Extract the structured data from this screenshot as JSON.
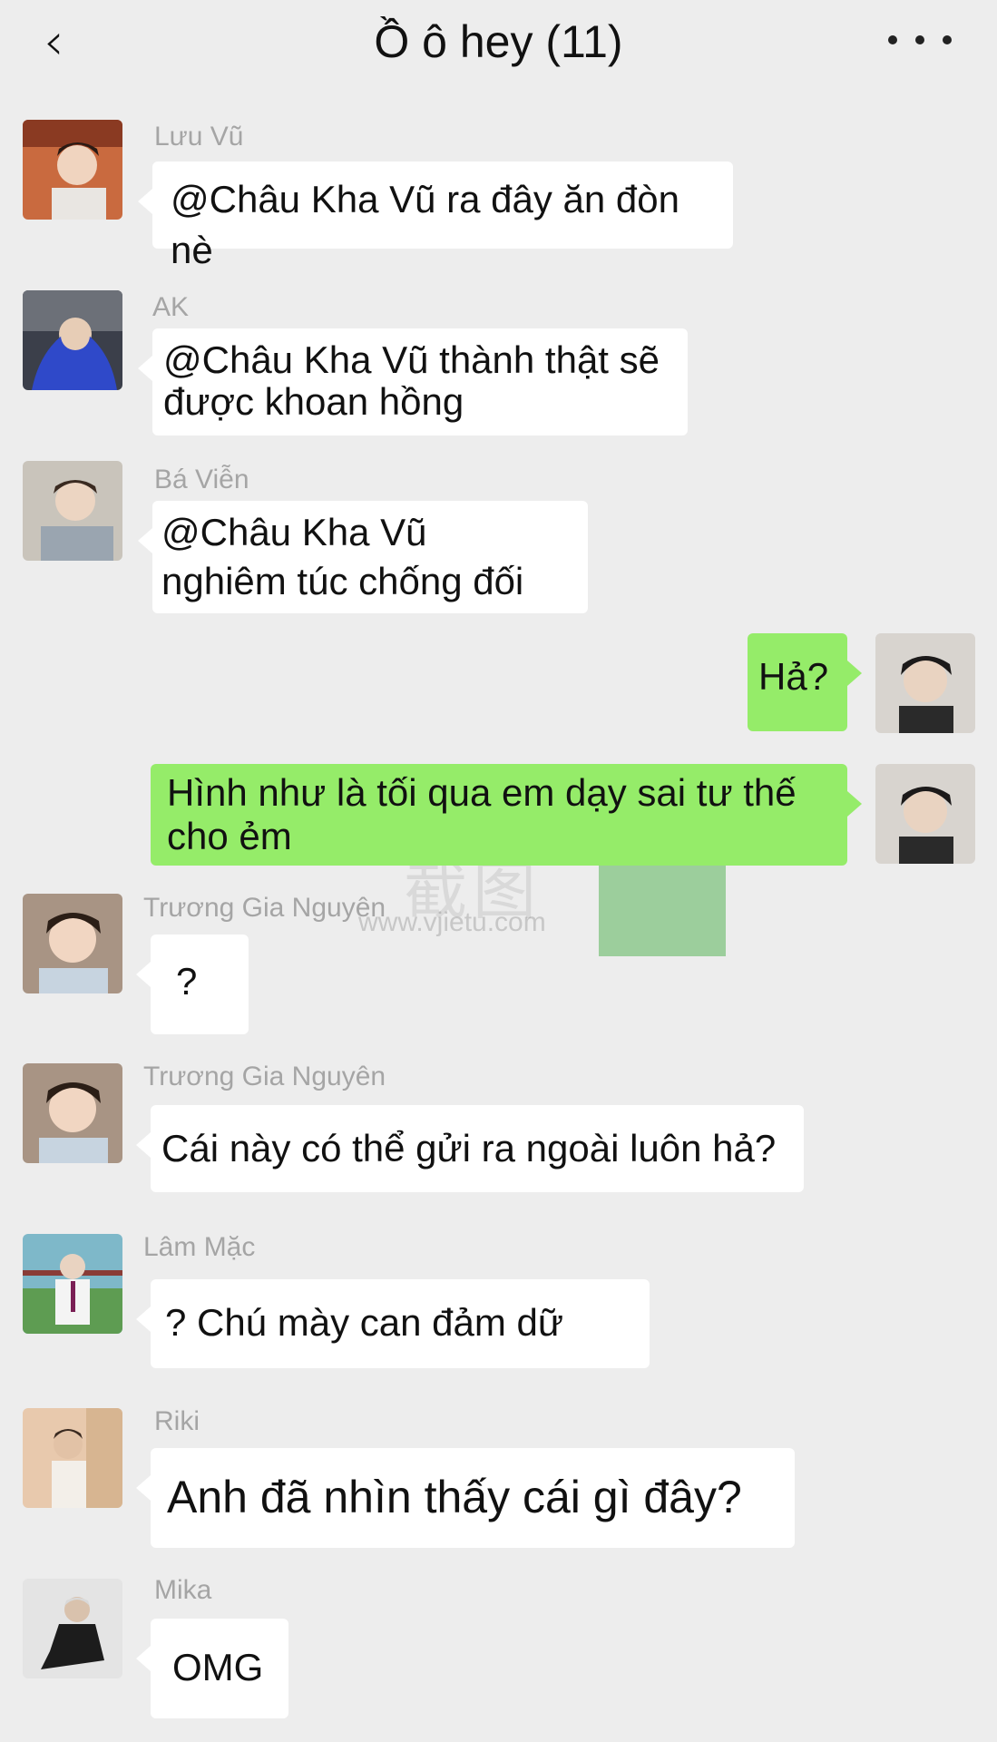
{
  "header": {
    "back_icon": "chevron-left-icon",
    "title": "Ồ ô hey (11)",
    "more_icon": "more-dots-icon"
  },
  "watermark": {
    "chinese": "截图",
    "url": "www.vjietu.com"
  },
  "messages": [
    {
      "sender": "Lưu Vũ",
      "text": "@Châu Kha Vũ ra đây ăn đòn nè",
      "side": "left"
    },
    {
      "sender": "AK",
      "text": "@Châu Kha Vũ thành thật sẽ\nđược khoan hồng",
      "side": "left"
    },
    {
      "sender": "Bá Viễn",
      "text": "@Châu Kha Vũ\nnghiêm túc chống đối",
      "side": "left"
    },
    {
      "sender": "",
      "text": "Hả?",
      "side": "right"
    },
    {
      "sender": "",
      "text": "Hình như là tối qua em dạy sai tư thế\ncho ẻm",
      "side": "right"
    },
    {
      "sender": "Trương Gia Nguyên",
      "text": "?",
      "side": "left"
    },
    {
      "sender": "Trương Gia Nguyên",
      "text": "Cái này có thể gửi ra ngoài luôn hả?",
      "side": "left"
    },
    {
      "sender": "Lâm Mặc",
      "text": "? Chú mày can đảm dữ",
      "side": "left"
    },
    {
      "sender": "Riki",
      "text": "Anh đã nhìn thấy cái gì đây?",
      "side": "left"
    },
    {
      "sender": "Mika",
      "text": "OMG",
      "side": "left"
    }
  ],
  "colors": {
    "background": "#ededed",
    "bubble_in": "#ffffff",
    "bubble_out": "#95ec69",
    "sender_name": "#a5a5a5"
  }
}
